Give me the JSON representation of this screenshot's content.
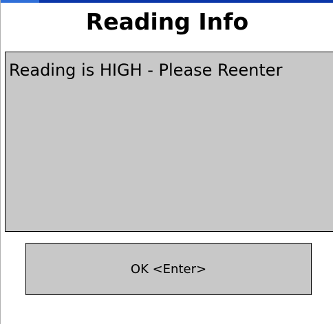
{
  "dialog": {
    "title": "Reading Info",
    "message": "Reading is HIGH - Please Reenter",
    "ok_label": "OK <Enter>"
  },
  "colors": {
    "background": "#ffffff",
    "panel": "#c8c8c8",
    "border": "#000000",
    "accent": "#0a36a8"
  }
}
